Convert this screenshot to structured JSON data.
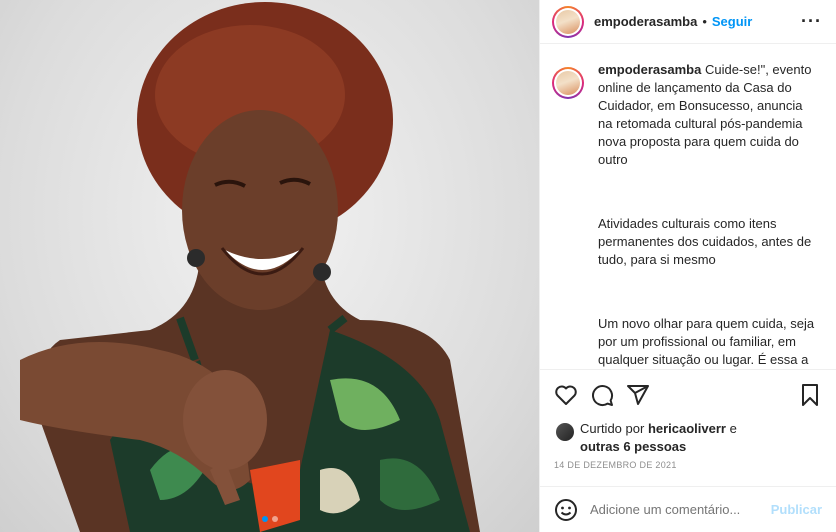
{
  "post": {
    "username": "empoderasamba",
    "separator": "•",
    "follow_label": "Seguir",
    "more_label": "···",
    "photo_pages": 2,
    "photo_active": 1
  },
  "caption": {
    "username": "empoderasamba",
    "first": "Cuide-se!\", evento online de lançamento da Casa do Cuidador, em Bonsucesso, anuncia na retomada cultural pós-pandemia nova proposta para quem cuida do outro",
    "second": "Atividades culturais como itens permanentes dos cuidados, antes de tudo, para si mesmo",
    "third": "Um novo olhar para quem cuida, seja por um profissional ou familiar, em qualquer situação ou lugar. É essa a proposta da Casa do Cuidador que"
  },
  "likes": {
    "prefix": "Curtido por",
    "user": "hericaoliverr",
    "mid": "e",
    "others": "outras 6 pessoas"
  },
  "date": "14 DE DEZEMBRO DE 2021",
  "comment": {
    "placeholder": "Adicione um comentário...",
    "post_label": "Publicar"
  },
  "icons": [
    "heart-icon",
    "comment-icon",
    "share-icon",
    "bookmark-icon",
    "emoji-icon",
    "more-icon"
  ],
  "colors": {
    "accent": "#0095f6",
    "muted": "#8e8e8e",
    "post_disabled": "#b2dffc"
  }
}
